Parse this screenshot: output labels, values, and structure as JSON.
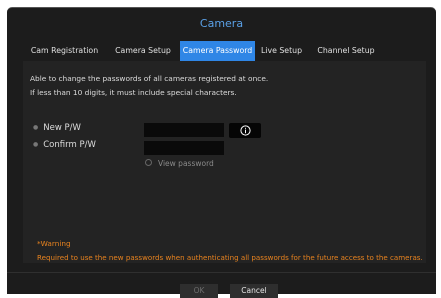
{
  "window": {
    "title": "Camera"
  },
  "tabs": [
    {
      "label": "Cam Registration",
      "active": false
    },
    {
      "label": "Camera Setup",
      "active": false
    },
    {
      "label": "Camera Password",
      "active": true
    },
    {
      "label": "Live Setup",
      "active": false
    },
    {
      "label": "Channel Setup",
      "active": false
    }
  ],
  "description": {
    "line1": "Able to change the passwords of all cameras registered at once.",
    "line2": "If less than 10 digits, it must include special characters."
  },
  "form": {
    "new_pw_label": "New P/W",
    "new_pw_value": "",
    "confirm_pw_label": "Confirm P/W",
    "confirm_pw_value": "",
    "info_icon": "info-icon",
    "view_password_label": "View password",
    "view_password_checked": false
  },
  "warning": {
    "title": "*Warning",
    "text": "Required to use the new passwords when authenticating all passwords for the future access to the cameras."
  },
  "footer": {
    "ok_label": "OK",
    "ok_enabled": false,
    "cancel_label": "Cancel"
  },
  "colors": {
    "accent": "#2f86e6",
    "title": "#5aa0e6",
    "warning": "#e8831f",
    "background": "#1c1c1c"
  }
}
